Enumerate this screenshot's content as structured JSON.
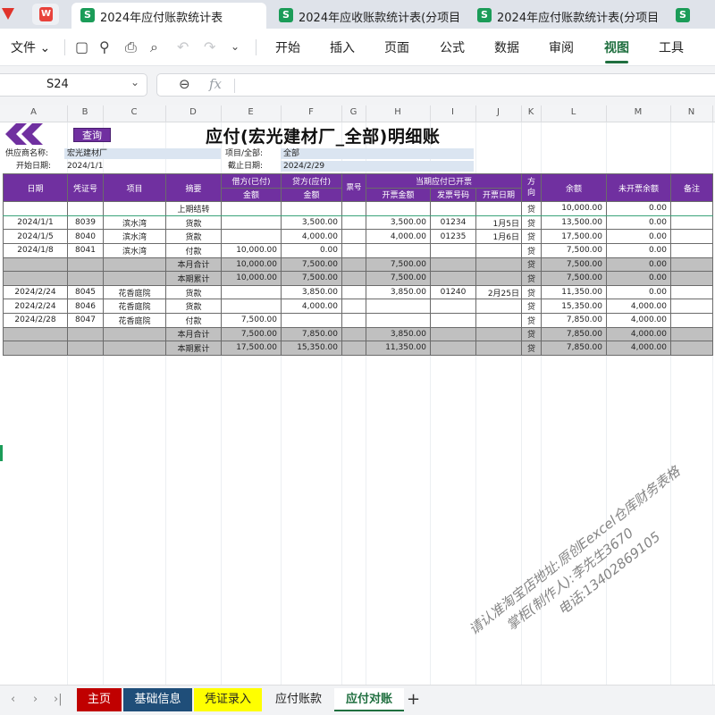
{
  "tabs": [
    {
      "title": "2024年应付账款统计表",
      "active": true
    },
    {
      "title": "2024年应收账款统计表(分项目",
      "active": false
    },
    {
      "title": "2024年应付账款统计表(分项目",
      "active": false
    },
    {
      "title": "",
      "active": false
    }
  ],
  "app_icons": {
    "s": "S",
    "wps": "W"
  },
  "menu": {
    "file": "文件",
    "tabs": [
      "开始",
      "插入",
      "页面",
      "公式",
      "数据",
      "审阅",
      "视图",
      "工具"
    ],
    "active_tab": "视图"
  },
  "formula_bar": {
    "cell_ref": "S24",
    "fx": "fx",
    "formula": ""
  },
  "columns": [
    "A",
    "B",
    "C",
    "D",
    "E",
    "F",
    "G",
    "H",
    "I",
    "J",
    "K",
    "L",
    "M",
    "N"
  ],
  "sheet": {
    "query_button": "查询",
    "title": "应付(宏光建材厂_全部)明细账",
    "supplier_label": "供应商名称:",
    "supplier_value": "宏光建材厂",
    "project_label": "项目/全部:",
    "project_value": "全部",
    "start_label": "开始日期:",
    "start_value": "2024/1/1",
    "end_label": "截止日期:",
    "end_value": "2024/2/29"
  },
  "ledger": {
    "headers": {
      "date": "日期",
      "voucher": "凭证号",
      "project": "项目",
      "summary": "摘要",
      "debit": "借方(已付)",
      "debit_sub": "金额",
      "credit": "贷方(应付)",
      "credit_sub": "金额",
      "ticket_no": "票号",
      "invoiced": "当期应付已开票",
      "invoice_amount": "开票金额",
      "invoice_no": "发票号码",
      "invoice_date": "开票日期",
      "direction": "方向",
      "balance": "余额",
      "uninvoiced": "未开票余额",
      "remark": "备注"
    },
    "rows": [
      {
        "type": "opening",
        "date": "",
        "voucher": "",
        "project": "",
        "summary": "上期结转",
        "debit": "",
        "credit": "",
        "ticket": "",
        "inv_amount": "",
        "inv_no": "",
        "inv_date": "",
        "dir": "贷",
        "balance": "10,000.00",
        "uninvoiced": "0.00",
        "remark": ""
      },
      {
        "type": "normal",
        "date": "2024/1/1",
        "voucher": "8039",
        "project": "滨水湾",
        "summary": "货款",
        "debit": "",
        "credit": "3,500.00",
        "ticket": "",
        "inv_amount": "3,500.00",
        "inv_no": "01234",
        "inv_date": "1月5日",
        "dir": "贷",
        "balance": "13,500.00",
        "uninvoiced": "0.00",
        "remark": ""
      },
      {
        "type": "normal",
        "date": "2024/1/5",
        "voucher": "8040",
        "project": "滨水湾",
        "summary": "货款",
        "debit": "",
        "credit": "4,000.00",
        "ticket": "",
        "inv_amount": "4,000.00",
        "inv_no": "01235",
        "inv_date": "1月6日",
        "dir": "贷",
        "balance": "17,500.00",
        "uninvoiced": "0.00",
        "remark": ""
      },
      {
        "type": "normal",
        "date": "2024/1/8",
        "voucher": "8041",
        "project": "滨水湾",
        "summary": "付款",
        "debit": "10,000.00",
        "credit": "0.00",
        "ticket": "",
        "inv_amount": "",
        "inv_no": "",
        "inv_date": "",
        "dir": "贷",
        "balance": "7,500.00",
        "uninvoiced": "0.00",
        "remark": ""
      },
      {
        "type": "sum",
        "date": "",
        "voucher": "",
        "project": "",
        "summary": "本月合计",
        "debit": "10,000.00",
        "credit": "7,500.00",
        "ticket": "",
        "inv_amount": "7,500.00",
        "inv_no": "",
        "inv_date": "",
        "dir": "贷",
        "balance": "7,500.00",
        "uninvoiced": "0.00",
        "remark": ""
      },
      {
        "type": "sum",
        "date": "",
        "voucher": "",
        "project": "",
        "summary": "本期累计",
        "debit": "10,000.00",
        "credit": "7,500.00",
        "ticket": "",
        "inv_amount": "7,500.00",
        "inv_no": "",
        "inv_date": "",
        "dir": "贷",
        "balance": "7,500.00",
        "uninvoiced": "0.00",
        "remark": ""
      },
      {
        "type": "normal",
        "date": "2024/2/24",
        "voucher": "8045",
        "project": "花香庭院",
        "summary": "货款",
        "debit": "",
        "credit": "3,850.00",
        "ticket": "",
        "inv_amount": "3,850.00",
        "inv_no": "01240",
        "inv_date": "2月25日",
        "dir": "贷",
        "balance": "11,350.00",
        "uninvoiced": "0.00",
        "remark": ""
      },
      {
        "type": "normal",
        "date": "2024/2/24",
        "voucher": "8046",
        "project": "花香庭院",
        "summary": "货款",
        "debit": "",
        "credit": "4,000.00",
        "ticket": "",
        "inv_amount": "",
        "inv_no": "",
        "inv_date": "",
        "dir": "贷",
        "balance": "15,350.00",
        "uninvoiced": "4,000.00",
        "remark": ""
      },
      {
        "type": "normal",
        "date": "2024/2/28",
        "voucher": "8047",
        "project": "花香庭院",
        "summary": "付款",
        "debit": "7,500.00",
        "credit": "",
        "ticket": "",
        "inv_amount": "",
        "inv_no": "",
        "inv_date": "",
        "dir": "贷",
        "balance": "7,850.00",
        "uninvoiced": "4,000.00",
        "remark": ""
      },
      {
        "type": "sum",
        "date": "",
        "voucher": "",
        "project": "",
        "summary": "本月合计",
        "debit": "7,500.00",
        "credit": "7,850.00",
        "ticket": "",
        "inv_amount": "3,850.00",
        "inv_no": "",
        "inv_date": "",
        "dir": "贷",
        "balance": "7,850.00",
        "uninvoiced": "4,000.00",
        "remark": ""
      },
      {
        "type": "sum",
        "date": "",
        "voucher": "",
        "project": "",
        "summary": "本期累计",
        "debit": "17,500.00",
        "credit": "15,350.00",
        "ticket": "",
        "inv_amount": "11,350.00",
        "inv_no": "",
        "inv_date": "",
        "dir": "贷",
        "balance": "7,850.00",
        "uninvoiced": "4,000.00",
        "remark": ""
      }
    ]
  },
  "watermark": {
    "line1": "请认准淘宝店地址:原创Eexcel仓库财务表格",
    "line2": "掌柜(制作人):李先生3670",
    "line3": "电话:13402869105"
  },
  "sheet_tabs": [
    {
      "label": "主页",
      "style": "main"
    },
    {
      "label": "基础信息",
      "style": "basic"
    },
    {
      "label": "凭证录入",
      "style": "voucher"
    },
    {
      "label": "应付账款",
      "style": "plain"
    },
    {
      "label": "应付对账",
      "style": "active"
    }
  ],
  "colors": {
    "header_purple": "#7030a0",
    "sum_gray": "#c0c0c0",
    "info_blue": "#dbe5f1",
    "active_green": "#1f6f3f"
  }
}
